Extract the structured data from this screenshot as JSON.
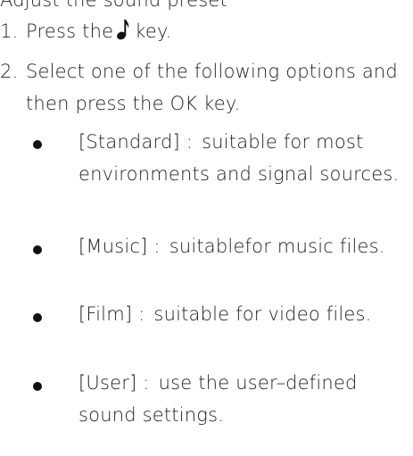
{
  "header_fragment": "Adjust the sound preset",
  "steps": [
    {
      "num": "1.",
      "before_icon": "Press the",
      "icon": "music-note-icon",
      "after_icon": "key."
    },
    {
      "num": "2.",
      "text": "Select one of the following options and then press the OK key."
    }
  ],
  "options": [
    {
      "label": "[Standard] :",
      "desc": "suitable for most environments and signal sources."
    },
    {
      "label": "[Music] :",
      "desc": "suitablefor music files."
    },
    {
      "label": "[Film] :",
      "desc": "suitable for video files."
    },
    {
      "label": "[User] :",
      "desc": "use the user–defined sound settings."
    }
  ]
}
